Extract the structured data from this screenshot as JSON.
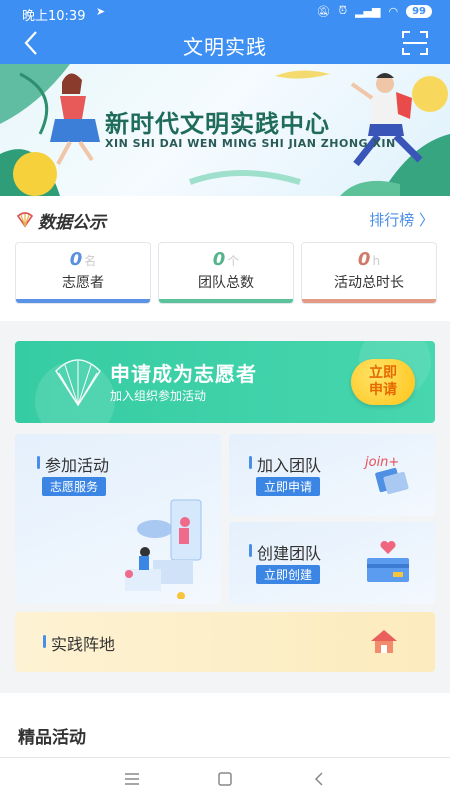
{
  "status_bar": {
    "time": "晚上10:39",
    "battery": "99"
  },
  "header": {
    "title": "文明实践"
  },
  "banner": {
    "title": "新时代文明实践中心",
    "subtitle": "XIN SHI DAI WEN MING SHI JIAN ZHONG XIN"
  },
  "data_section": {
    "title": "数据公示",
    "rank_link": "排行榜",
    "stats": [
      {
        "value": "0",
        "unit": "名",
        "label": "志愿者",
        "color": "#5b8fe0",
        "bar": "#5a93e6"
      },
      {
        "value": "0",
        "unit": "个",
        "label": "团队总数",
        "color": "#55b48e",
        "bar": "#5bc39a"
      },
      {
        "value": "0",
        "unit": "h",
        "label": "活动总时长",
        "color": "#d07a6a",
        "bar": "#e49a84"
      }
    ]
  },
  "apply": {
    "title": "申请成为志愿者",
    "subtitle": "加入组织参加活动",
    "button": "立即\n申请"
  },
  "tiles": {
    "activity": {
      "title": "参加活动",
      "tag": "志愿服务"
    },
    "join_team": {
      "title": "加入团队",
      "tag": "立即申请",
      "icon_text": "join+"
    },
    "create_team": {
      "title": "创建团队",
      "tag": "立即创建"
    },
    "base": {
      "title": "实践阵地"
    }
  },
  "featured": {
    "title": "精品活动"
  },
  "colors": {
    "primary": "#3e8ff3",
    "green": "#36cca3",
    "tag_blue": "#3b86e5"
  }
}
